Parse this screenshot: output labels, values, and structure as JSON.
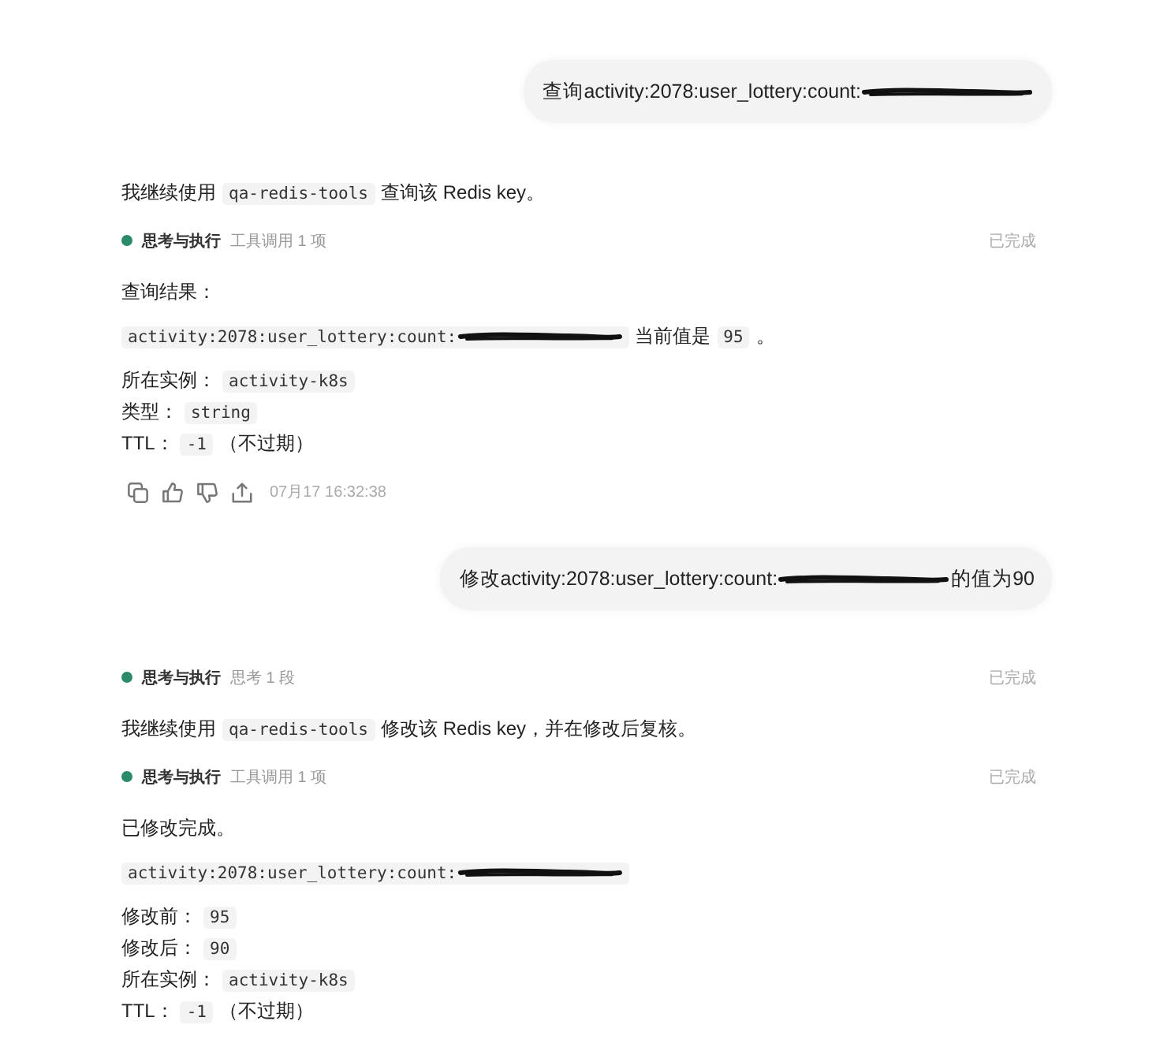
{
  "conversation": [
    {
      "kind": "user",
      "parts": [
        {
          "kind": "text",
          "text": "查询activity:2078:user_lottery:count:"
        },
        {
          "kind": "scribble"
        }
      ]
    },
    {
      "kind": "assistant",
      "blocks": [
        {
          "kind": "paragraph",
          "parts": [
            {
              "kind": "text",
              "text": "我继续使用"
            },
            {
              "kind": "code",
              "text": "qa-redis-tools"
            },
            {
              "kind": "text",
              "text": "查询该 Redis key。"
            }
          ]
        },
        {
          "kind": "status",
          "title": "思考与执行",
          "detail": "工具调用 1 项",
          "status_text": "已完成"
        },
        {
          "kind": "paragraph",
          "parts": [
            {
              "kind": "text",
              "text": "查询结果："
            }
          ]
        },
        {
          "kind": "result",
          "parts": [
            {
              "kind": "code",
              "text": "activity:2078:user_lottery:count:"
            },
            {
              "kind": "scribble"
            },
            {
              "kind": "text",
              "text": "当前值是"
            },
            {
              "kind": "code",
              "text": "95"
            },
            {
              "kind": "text",
              "text": "。"
            }
          ]
        },
        {
          "kind": "field",
          "parts": [
            {
              "kind": "text",
              "text": "所在实例："
            },
            {
              "kind": "code",
              "text": "activity-k8s"
            }
          ]
        },
        {
          "kind": "field",
          "parts": [
            {
              "kind": "text",
              "text": "类型："
            },
            {
              "kind": "code",
              "text": "string"
            }
          ]
        },
        {
          "kind": "field",
          "parts": [
            {
              "kind": "text",
              "text": "TTL："
            },
            {
              "kind": "code",
              "text": "-1"
            },
            {
              "kind": "text",
              "text": "（不过期）"
            }
          ]
        }
      ],
      "timestamp": "07月17 16:32:38"
    },
    {
      "kind": "user",
      "parts": [
        {
          "kind": "text",
          "text": "修改activity:2078:user_lottery:count:"
        },
        {
          "kind": "scribble"
        },
        {
          "kind": "text",
          "text": "的值为90"
        }
      ]
    },
    {
      "kind": "assistant",
      "blocks": [
        {
          "kind": "status",
          "title": "思考与执行",
          "detail": "思考 1 段",
          "status_text": "已完成"
        },
        {
          "kind": "paragraph",
          "parts": [
            {
              "kind": "text",
              "text": "我继续使用"
            },
            {
              "kind": "code",
              "text": "qa-redis-tools"
            },
            {
              "kind": "text",
              "text": "修改该 Redis key，并在修改后复核。"
            }
          ]
        },
        {
          "kind": "status",
          "title": "思考与执行",
          "detail": "工具调用 1 项",
          "status_text": "已完成"
        },
        {
          "kind": "paragraph",
          "parts": [
            {
              "kind": "text",
              "text": "已修改完成。"
            }
          ]
        },
        {
          "kind": "result",
          "parts": [
            {
              "kind": "code",
              "text": "activity:2078:user_lottery:count:"
            },
            {
              "kind": "scribble"
            }
          ]
        },
        {
          "kind": "field",
          "parts": [
            {
              "kind": "text",
              "text": "修改前："
            },
            {
              "kind": "code",
              "text": "95"
            }
          ]
        },
        {
          "kind": "field",
          "parts": [
            {
              "kind": "text",
              "text": "修改后："
            },
            {
              "kind": "code",
              "text": "90"
            }
          ]
        },
        {
          "kind": "field",
          "parts": [
            {
              "kind": "text",
              "text": "所在实例："
            },
            {
              "kind": "code",
              "text": "activity-k8s"
            }
          ]
        },
        {
          "kind": "field",
          "parts": [
            {
              "kind": "text",
              "text": "TTL："
            },
            {
              "kind": "code",
              "text": "-1"
            },
            {
              "kind": "text",
              "text": "（不过期）"
            }
          ]
        }
      ]
    }
  ]
}
